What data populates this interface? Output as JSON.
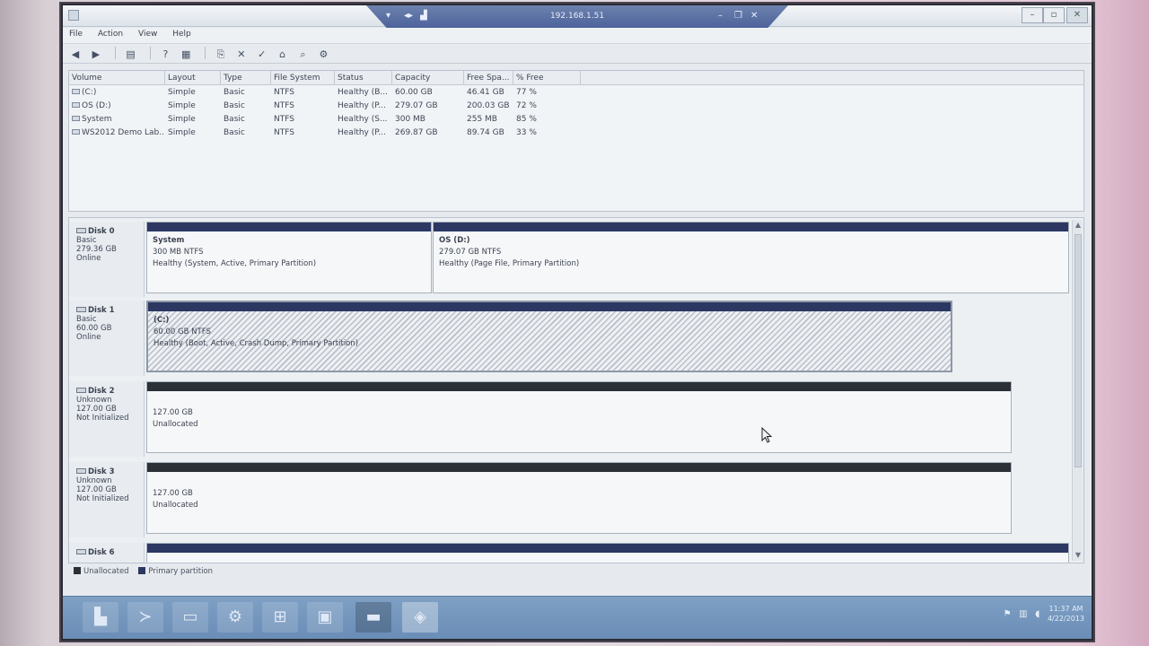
{
  "rdp": {
    "host": "192.168.1.51"
  },
  "menu": [
    "File",
    "Action",
    "View",
    "Help"
  ],
  "toolbar": {
    "icons": [
      "back-icon",
      "forward-icon",
      "console-tree-icon",
      "help-icon",
      "properties-icon",
      "export-icon",
      "delete-icon",
      "check-icon",
      "open-folder-icon",
      "search-icon",
      "settings-icon"
    ]
  },
  "volume_table": {
    "headers": [
      "Volume",
      "Layout",
      "Type",
      "File System",
      "Status",
      "Capacity",
      "Free Spa...",
      "% Free"
    ],
    "rows": [
      [
        "(C:)",
        "Simple",
        "Basic",
        "NTFS",
        "Healthy (B...",
        "60.00 GB",
        "46.41 GB",
        "77 %"
      ],
      [
        "OS (D:)",
        "Simple",
        "Basic",
        "NTFS",
        "Healthy (P...",
        "279.07 GB",
        "200.03 GB",
        "72 %"
      ],
      [
        "System",
        "Simple",
        "Basic",
        "NTFS",
        "Healthy (S...",
        "300 MB",
        "255 MB",
        "85 %"
      ],
      [
        "WS2012 Demo Lab...",
        "Simple",
        "Basic",
        "NTFS",
        "Healthy (P...",
        "269.87 GB",
        "89.74 GB",
        "33 %"
      ]
    ]
  },
  "disks": [
    {
      "name": "Disk 0",
      "type": "Basic",
      "size": "279.36 GB",
      "status": "Online",
      "partitions": [
        {
          "name": "System",
          "size": "300 MB NTFS",
          "status": "Healthy (System, Active, Primary Partition)"
        },
        {
          "name": "OS  (D:)",
          "size": "279.07 GB NTFS",
          "status": "Healthy (Page File, Primary Partition)"
        }
      ]
    },
    {
      "name": "Disk 1",
      "type": "Basic",
      "size": "60.00 GB",
      "status": "Online",
      "partitions": [
        {
          "name": "(C:)",
          "size": "60.00 GB NTFS",
          "status": "Healthy (Boot, Active, Crash Dump, Primary Partition)"
        }
      ]
    },
    {
      "name": "Disk 2",
      "type": "Unknown",
      "size": "127.00 GB",
      "status": "Not Initialized",
      "partitions": [
        {
          "name": "",
          "size": "127.00 GB",
          "status": "Unallocated"
        }
      ]
    },
    {
      "name": "Disk 3",
      "type": "Unknown",
      "size": "127.00 GB",
      "status": "Not Initialized",
      "partitions": [
        {
          "name": "",
          "size": "127.00 GB",
          "status": "Unallocated"
        }
      ]
    },
    {
      "name": "Disk 6"
    }
  ],
  "legend": {
    "unallocated": "Unallocated",
    "primary": "Primary partition",
    "unallocated_color": "#2b2f36",
    "primary_color": "#2c3862"
  },
  "taskbar": {
    "icons": [
      "server-manager-icon",
      "powershell-icon",
      "file-explorer-icon",
      "settings-icon",
      "network-icon",
      "computer-management-icon",
      "cmd-icon",
      "disk-management-icon"
    ],
    "active_index": 7
  },
  "tray": {
    "time": "11:37 AM",
    "date": "4/22/2013"
  },
  "colors": {
    "accent": "#4b629b",
    "primary_partition": "#2c3862",
    "taskbar": "#7095be"
  }
}
